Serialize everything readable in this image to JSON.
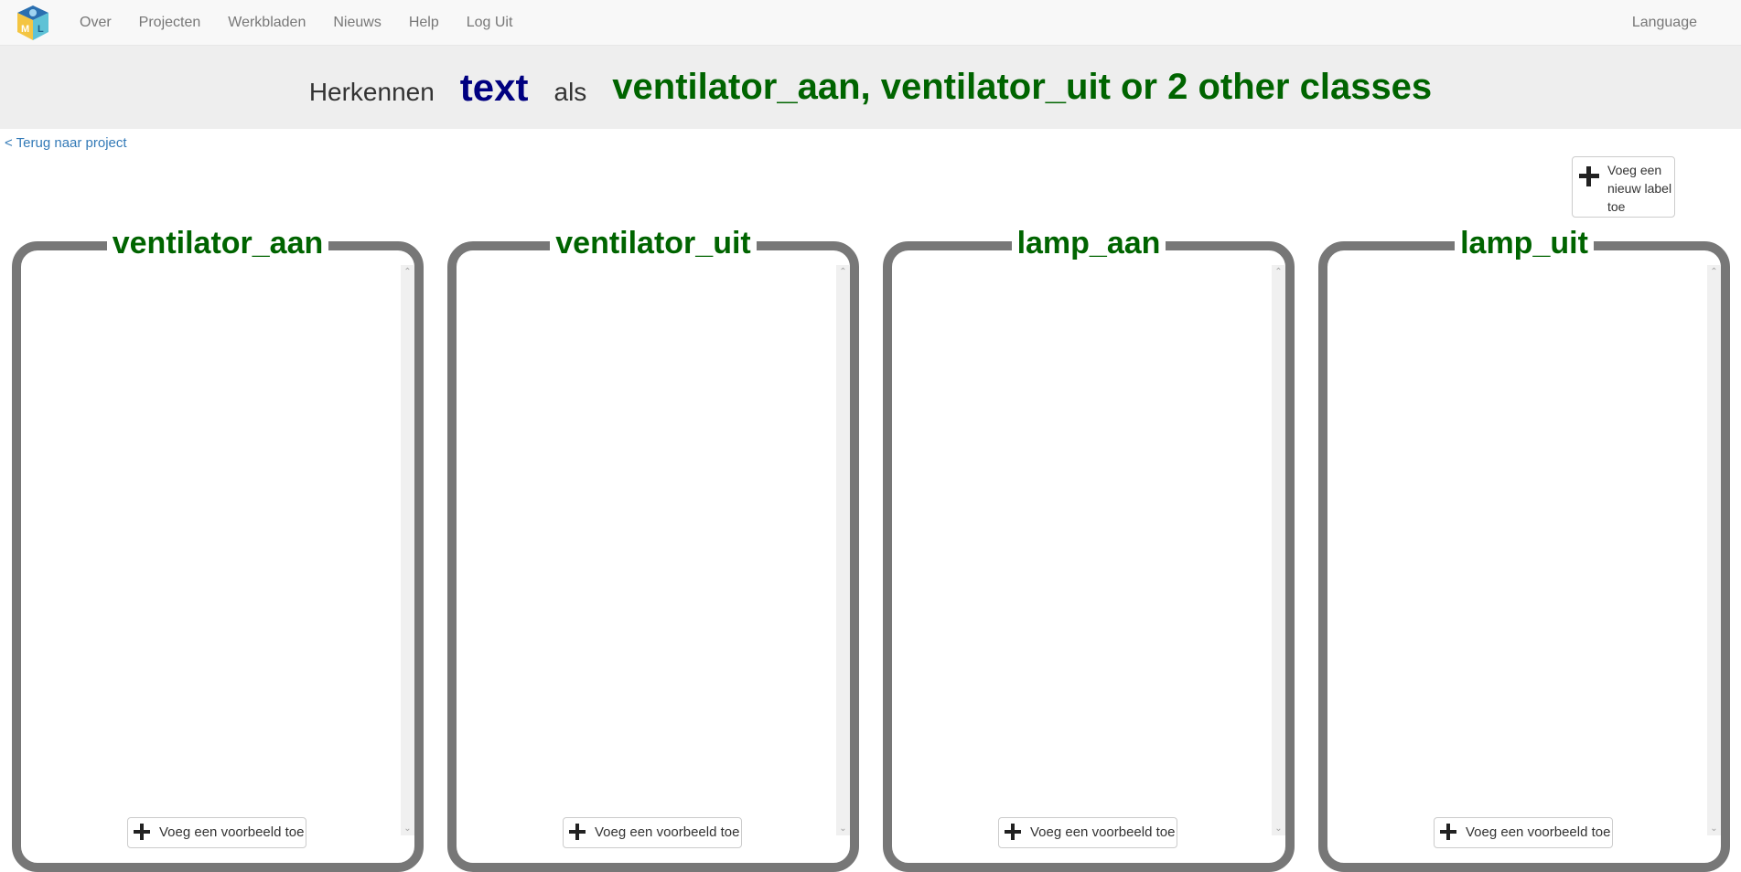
{
  "navbar": {
    "links": [
      {
        "label": "Over"
      },
      {
        "label": "Projecten"
      },
      {
        "label": "Werkbladen"
      },
      {
        "label": "Nieuws"
      },
      {
        "label": "Help"
      },
      {
        "label": "Log Uit"
      }
    ],
    "language": "Language",
    "logo_letters": [
      "M",
      "L"
    ]
  },
  "header": {
    "recognise": "Herkennen",
    "type": "text",
    "as": "als",
    "classes": "ventilator_aan, ventilator_uit or 2 other classes"
  },
  "back_link": "< Terug naar project",
  "add_label_button": "Voeg een nieuw label toe",
  "labels": [
    {
      "name": "ventilator_aan",
      "add_example": "Voeg een voorbeeld toe"
    },
    {
      "name": "ventilator_uit",
      "add_example": "Voeg een voorbeeld toe"
    },
    {
      "name": "lamp_aan",
      "add_example": "Voeg een voorbeeld toe"
    },
    {
      "name": "lamp_uit",
      "add_example": "Voeg een voorbeeld toe"
    }
  ],
  "colors": {
    "label_green": "#006400",
    "type_navy": "#000080",
    "frame_grey": "#777777",
    "link_blue": "#337ab7"
  }
}
